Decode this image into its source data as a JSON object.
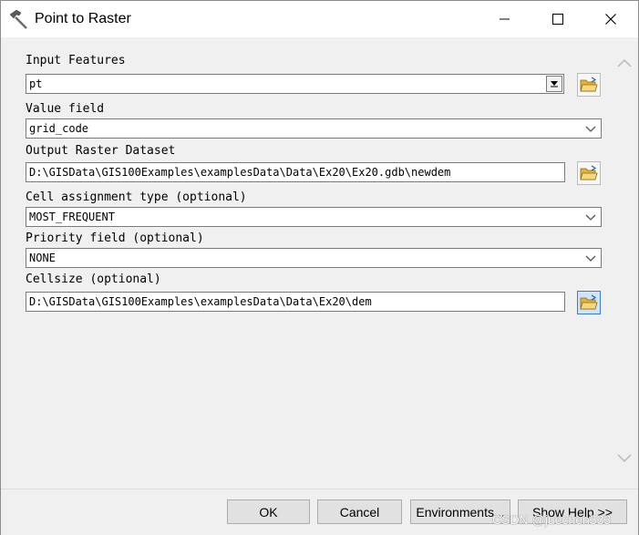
{
  "window": {
    "title": "Point to Raster"
  },
  "fields": {
    "input_features": {
      "label": "Input Features",
      "value": "pt"
    },
    "value_field": {
      "label": "Value field",
      "value": "grid_code"
    },
    "output_raster": {
      "label": "Output Raster Dataset",
      "value": "D:\\GISData\\GIS100Examples\\examplesData\\Data\\Ex20\\Ex20.gdb\\newdem"
    },
    "cell_assignment": {
      "label": "Cell assignment type (optional)",
      "value": "MOST_FREQUENT"
    },
    "priority_field": {
      "label": "Priority field (optional)",
      "value": "NONE"
    },
    "cellsize": {
      "label": "Cellsize (optional)",
      "value": "D:\\GISData\\GIS100Examples\\examplesData\\Data\\Ex20\\dem"
    }
  },
  "buttons": {
    "ok": "OK",
    "cancel": "Cancel",
    "environments": "Environments...",
    "show_help": "Show Help >>"
  },
  "watermark": "CSDN @juechen333",
  "icons": {
    "app": "hammer-icon",
    "browse": "folder-open-icon"
  }
}
